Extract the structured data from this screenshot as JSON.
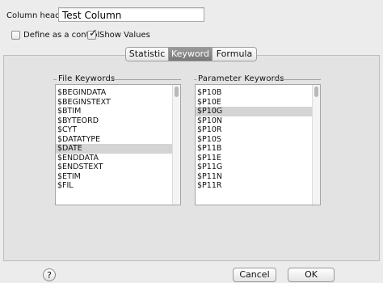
{
  "header": {
    "column_heading_label": "Column heading:",
    "column_heading_value": "Test Column"
  },
  "options": {
    "define_control": {
      "label": "Define as a control",
      "checked": false
    },
    "show_values": {
      "label": "Show Values",
      "checked": true
    }
  },
  "tabs": [
    {
      "label": "Statistic",
      "active": false
    },
    {
      "label": "Keyword",
      "active": true
    },
    {
      "label": "Formula",
      "active": false
    }
  ],
  "file_keywords": {
    "title": "File Keywords",
    "items": [
      "$BEGINDATA",
      "$BEGINSTEXT",
      "$BTIM",
      "$BYTEORD",
      "$CYT",
      "$DATATYPE",
      "$DATE",
      "$ENDDATA",
      "$ENDSTEXT",
      "$ETIM",
      "$FIL"
    ],
    "selected": "$DATE"
  },
  "parameter_keywords": {
    "title": "Parameter Keywords",
    "items": [
      "$P10B",
      "$P10E",
      "$P10G",
      "$P10N",
      "$P10R",
      "$P10S",
      "$P11B",
      "$P11E",
      "$P11G",
      "$P11N",
      "$P11R"
    ],
    "selected": "$P10G"
  },
  "buttons": {
    "help": "?",
    "cancel": "Cancel",
    "ok": "OK"
  }
}
